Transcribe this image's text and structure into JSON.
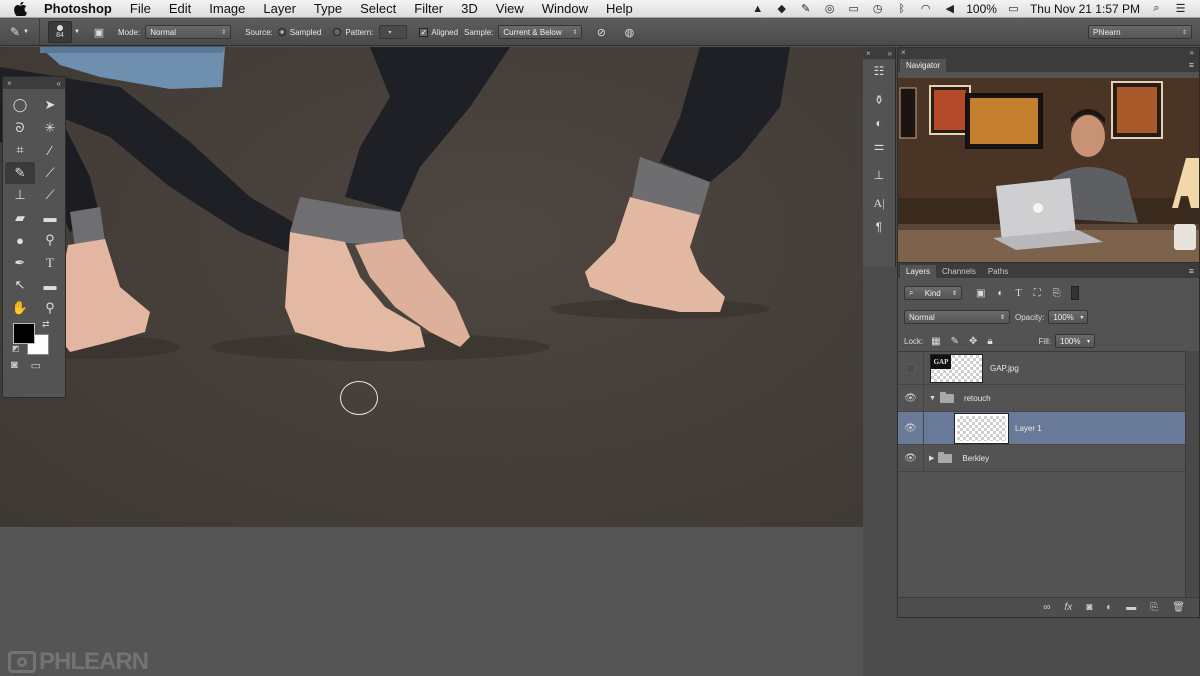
{
  "menubar": {
    "app_name": "Photoshop",
    "items": [
      "File",
      "Edit",
      "Image",
      "Layer",
      "Type",
      "Select",
      "Filter",
      "3D",
      "View",
      "Window",
      "Help"
    ],
    "battery": "100%",
    "clock": "Thu Nov 21  1:57 PM"
  },
  "options": {
    "brush_size": "84",
    "mode_label": "Mode:",
    "mode_value": "Normal",
    "source_label": "Source:",
    "sampled_label": "Sampled",
    "pattern_label": "Pattern:",
    "aligned_label": "Aligned",
    "sample_label": "Sample:",
    "sample_value": "Current & Below",
    "workspace": "Phlearn"
  },
  "navigator": {
    "tab": "Navigator"
  },
  "layers": {
    "tabs": [
      "Layers",
      "Channels",
      "Paths"
    ],
    "filter_kind": "Kind",
    "blend_mode": "Normal",
    "opacity_label": "Opacity:",
    "opacity_value": "100%",
    "lock_label": "Lock:",
    "fill_label": "Fill:",
    "fill_value": "100%",
    "items": [
      {
        "name": "GAP.jpg",
        "thumb_text": "GAP"
      },
      {
        "name": "retouch"
      },
      {
        "name": "Layer 1"
      },
      {
        "name": "Berkley"
      }
    ]
  },
  "watermark": {
    "text": "PHLEARN"
  },
  "colors": {
    "selected_layer": "#687a97",
    "foreground": "#000000",
    "background": "#ffffff"
  }
}
